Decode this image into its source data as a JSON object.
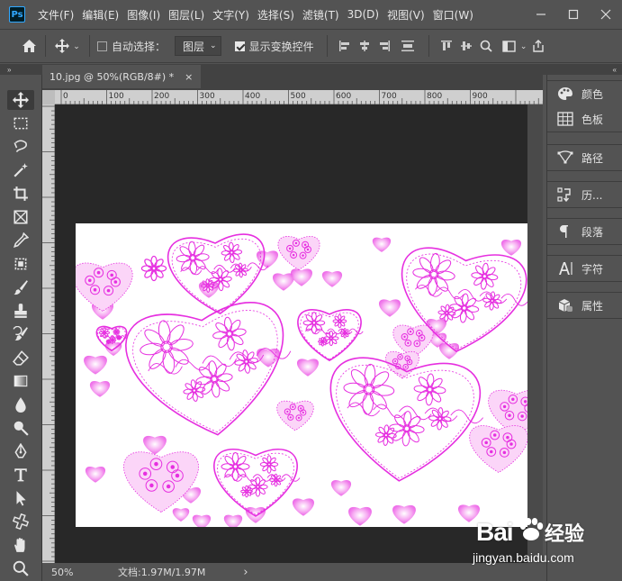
{
  "app": {
    "logo_text": "Ps",
    "menu": [
      "文件(F)",
      "编辑(E)",
      "图像(I)",
      "图层(L)",
      "文字(Y)",
      "选择(S)",
      "滤镜(T)",
      "3D(D)",
      "视图(V)",
      "窗口(W)"
    ],
    "window_controls": [
      "minimize-icon",
      "maximize-icon",
      "close-icon"
    ]
  },
  "options_bar": {
    "auto_select_label": "自动选择：",
    "auto_select_checked": false,
    "layer_select_value": "图层",
    "show_transform_label": "显示变换控件",
    "show_transform_checked": true
  },
  "panel_strips": {
    "left_collapse": "»",
    "right_collapse": "«"
  },
  "document": {
    "tab_title": "10.jpg @ 50%(RGB/8#) *",
    "tab_close": "×",
    "ruler_ticks": [
      "0",
      "100",
      "200",
      "300",
      "400",
      "500",
      "600",
      "700",
      "800",
      "900"
    ],
    "zoom": "50%",
    "doc_info": "文档:1.97M/1.97M",
    "status_arrow": "›",
    "heart_color": "#e62fe0",
    "heart_fill": "#f6a6f1"
  },
  "tools": [
    "move-tool-icon",
    "marquee-tool-icon",
    "lasso-tool-icon",
    "magic-wand-tool-icon",
    "crop-tool-icon",
    "frame-tool-icon",
    "eyedropper-tool-icon",
    "patch-tool-icon",
    "brush-tool-icon",
    "stamp-tool-icon",
    "history-brush-tool-icon",
    "eraser-tool-icon",
    "gradient-tool-icon",
    "blur-tool-icon",
    "dodge-tool-icon",
    "pen-tool-icon",
    "type-tool-icon",
    "path-select-tool-icon",
    "shape-tool-icon",
    "hand-tool-icon",
    "zoom-tool-icon"
  ],
  "panels": {
    "group1": [
      {
        "label": "颜色",
        "icon": "palette-icon"
      },
      {
        "label": "色板",
        "icon": "swatches-icon"
      }
    ],
    "group2": [
      {
        "label": "路径",
        "icon": "paths-icon"
      }
    ],
    "group3": [
      {
        "label": "历...",
        "icon": "history-icon"
      }
    ],
    "group4": [
      {
        "label": "段落",
        "icon": "paragraph-icon"
      }
    ],
    "group5": [
      {
        "label": "字符",
        "icon": "character-icon"
      }
    ],
    "group6": [
      {
        "label": "属性",
        "icon": "properties-icon"
      }
    ]
  },
  "watermark": {
    "brand": "Bai",
    "brand2": "经验",
    "url": "jingyan.baidu.com"
  }
}
